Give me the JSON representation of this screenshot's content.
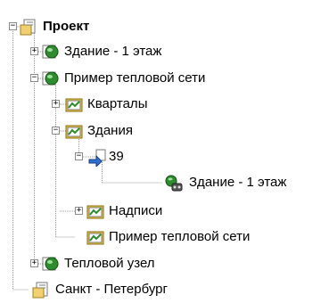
{
  "tree": {
    "root": {
      "label": "Проект",
      "icon": "project-icon",
      "expanded": true
    },
    "items": [
      {
        "label": "Здание - 1 этаж",
        "icon": "globe-layer-icon",
        "expanded": false
      },
      {
        "label": "Пример тепловой сети",
        "icon": "globe-layer-icon",
        "expanded": true
      },
      {
        "label": "Кварталы",
        "icon": "map-folder-icon",
        "expanded": false
      },
      {
        "label": "Здания",
        "icon": "map-folder-icon",
        "expanded": true
      },
      {
        "label": "39",
        "icon": "object-link-icon",
        "expanded": true
      },
      {
        "label": "Здание - 1 этаж",
        "icon": "building-object-icon"
      },
      {
        "label": "Надписи",
        "icon": "map-folder-icon",
        "expanded": false
      },
      {
        "label": "Пример тепловой сети",
        "icon": "map-folder-icon"
      },
      {
        "label": "Тепловой узел",
        "icon": "globe-layer-icon",
        "expanded": false
      },
      {
        "label": "Санкт - Петербург",
        "icon": "project-icon"
      }
    ]
  },
  "colors": {
    "connector": "#9a9a9a",
    "globe": "#2e8b2e",
    "folder": "#e8c84a",
    "link": "#2f6fd0"
  }
}
